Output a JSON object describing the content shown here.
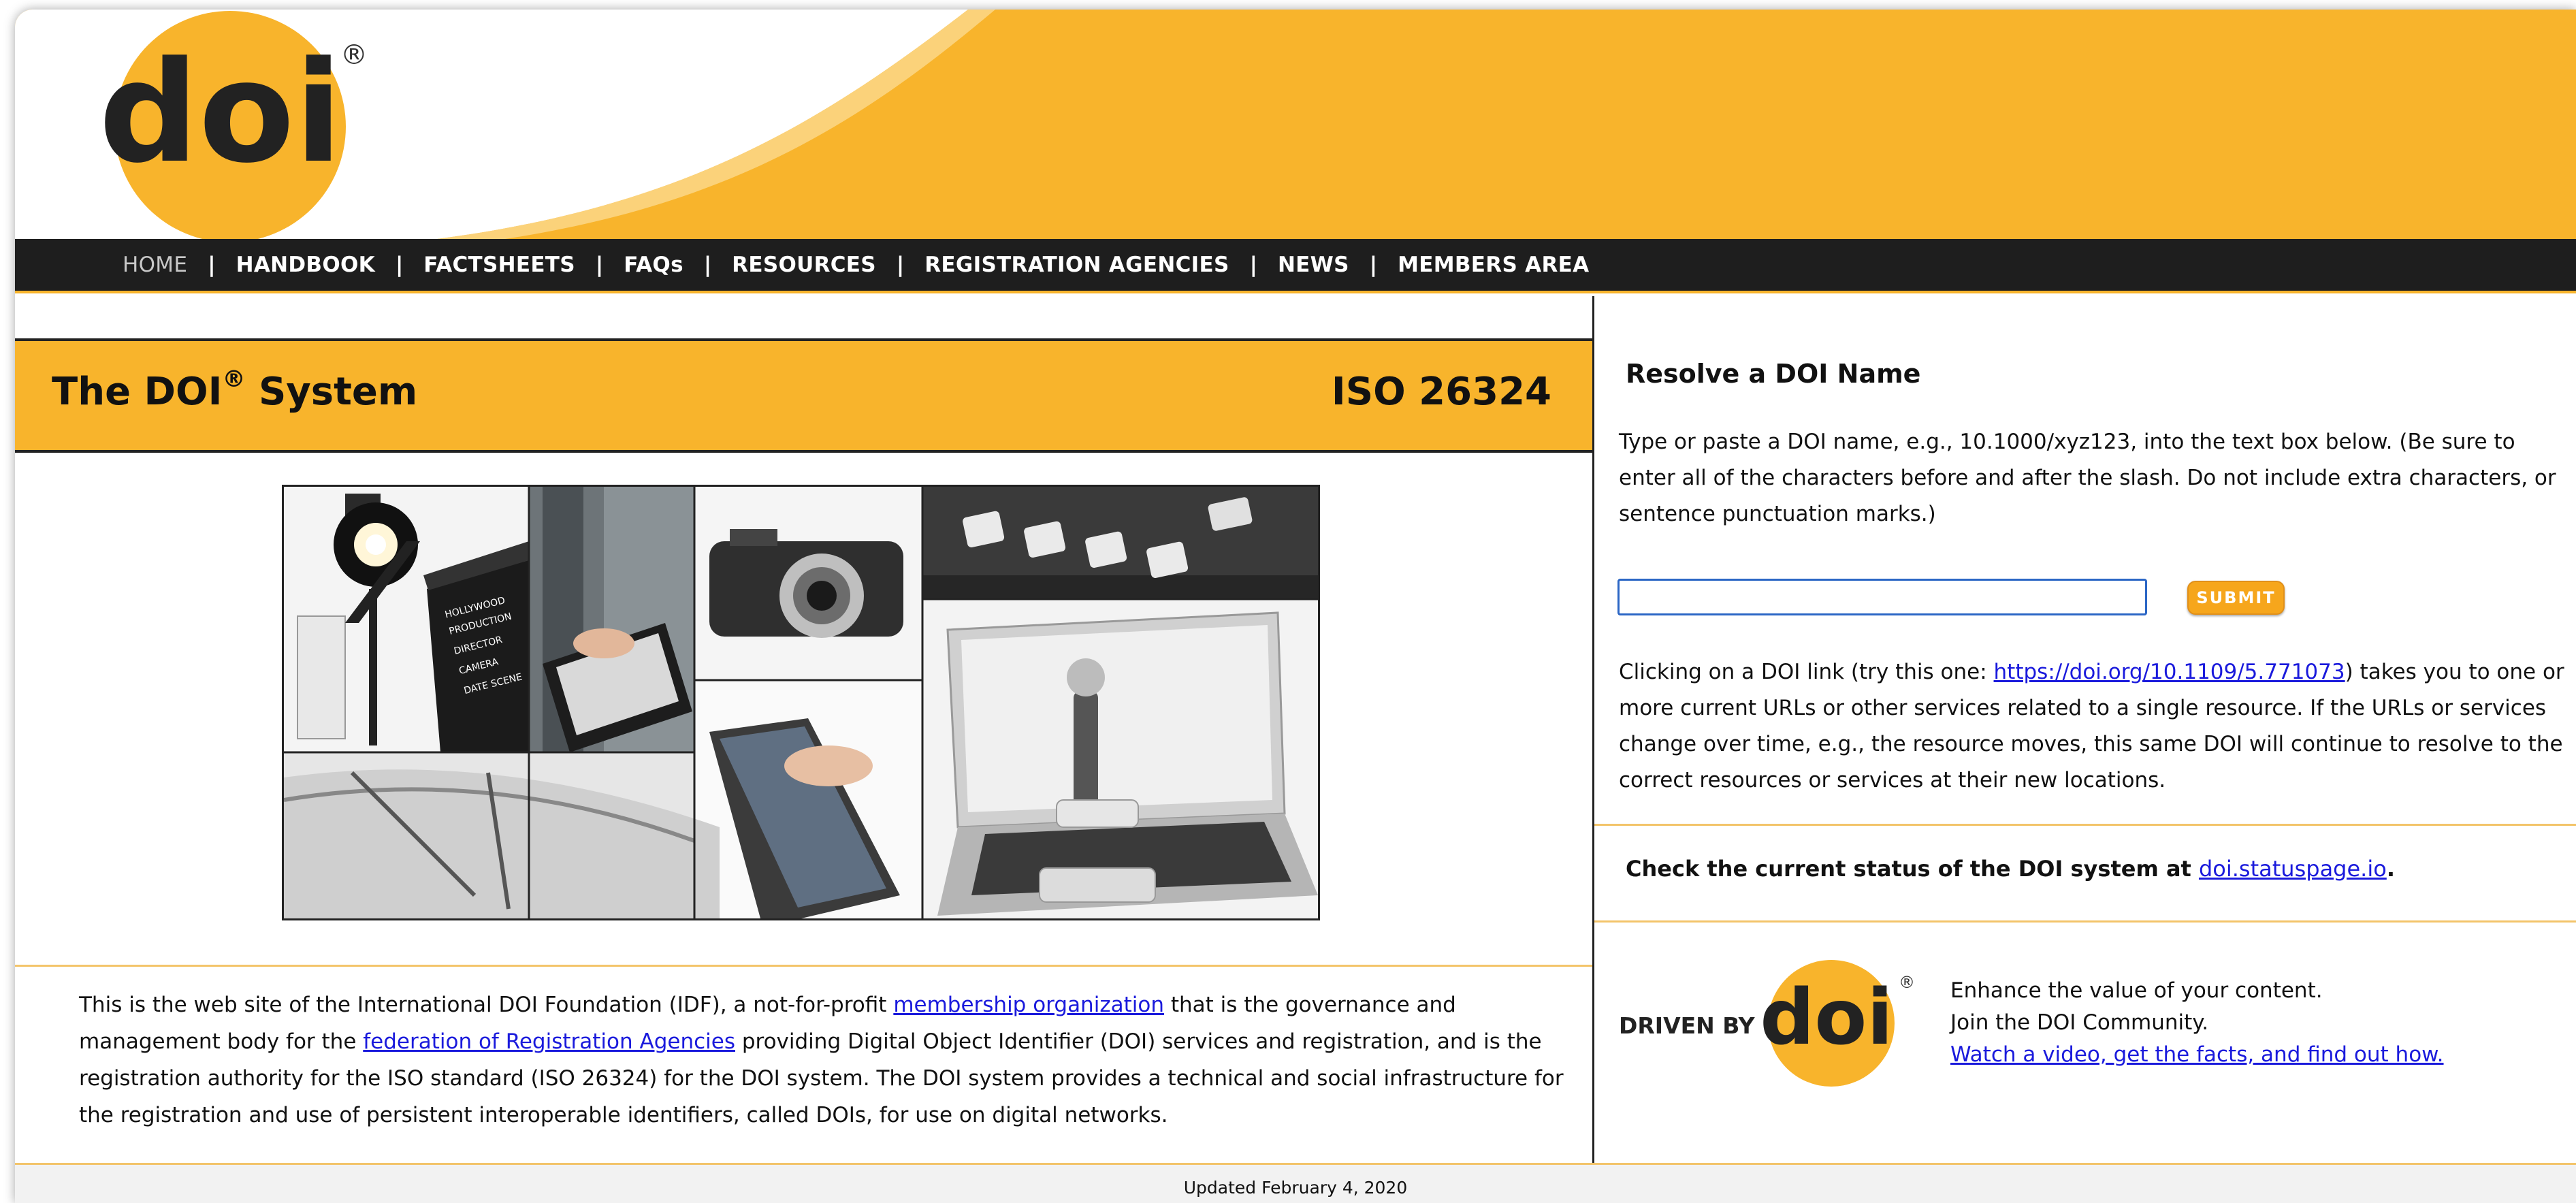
{
  "brand": {
    "logo_text": "doi",
    "registered_mark": "®",
    "driven_by_text": "DRIVEN BY",
    "colors": {
      "orange": "#f8b42c",
      "nav_bg": "#1e1e1e",
      "link": "#1a1adc"
    }
  },
  "nav": {
    "items": [
      {
        "label": "HOME",
        "active": true
      },
      {
        "label": "HANDBOOK"
      },
      {
        "label": "FACTSHEETS"
      },
      {
        "label": "FAQs"
      },
      {
        "label": "RESOURCES"
      },
      {
        "label": "REGISTRATION AGENCIES"
      },
      {
        "label": "NEWS"
      },
      {
        "label": "MEMBERS AREA"
      }
    ],
    "separator": "|"
  },
  "main": {
    "title": "The DOI",
    "title_mark": "®",
    "title_suffix": " System",
    "iso": "ISO 26324",
    "intro": {
      "part1": "This is the web site of the International DOI Foundation (IDF), a not-for-profit ",
      "link1": "membership organization",
      "part2": " that is the governance and management body for the ",
      "link2": "federation of Registration Agencies",
      "part3": " providing Digital Object Identifier (DOI) services and registration, and is the registration authority for the ISO standard (ISO 26324) for the DOI system. The DOI system provides a technical and social infrastructure for the registration and use of persistent interoperable identifiers, called DOIs, for use on digital networks."
    },
    "collage": {
      "clapper_lines": [
        "HOLLYWOOD",
        "PRODUCTION",
        "DIRECTOR",
        "CAMERA",
        "DATE     SCENE"
      ]
    }
  },
  "resolve": {
    "title": "Resolve a DOI Name",
    "description": "Type or paste a DOI name, e.g., 10.1000/xyz123, into the text box below. (Be sure to enter all of the characters before and after the slash. Do not include extra characters, or sentence punctuation marks.)",
    "input_value": "",
    "submit_label": "SUBMIT",
    "click_part1": "Clicking on a DOI link (try this one: ",
    "click_link": "https://doi.org/10.1109/5.771073",
    "click_part2": ") takes you to one or more current URLs or other services related to a single resource. If the URLs or services change over time, e.g., the resource moves, this same DOI will continue to resolve to the correct resources or services at their new locations."
  },
  "status": {
    "text": "Check the current status of the DOI system at ",
    "link": "doi.statuspage.io",
    "end": "."
  },
  "community": {
    "line1": "Enhance the value of your content.",
    "line2": "Join the DOI Community.",
    "link": "Watch a video, get the facts, and find out how."
  },
  "footer": {
    "updated": "Updated February 4, 2020"
  }
}
